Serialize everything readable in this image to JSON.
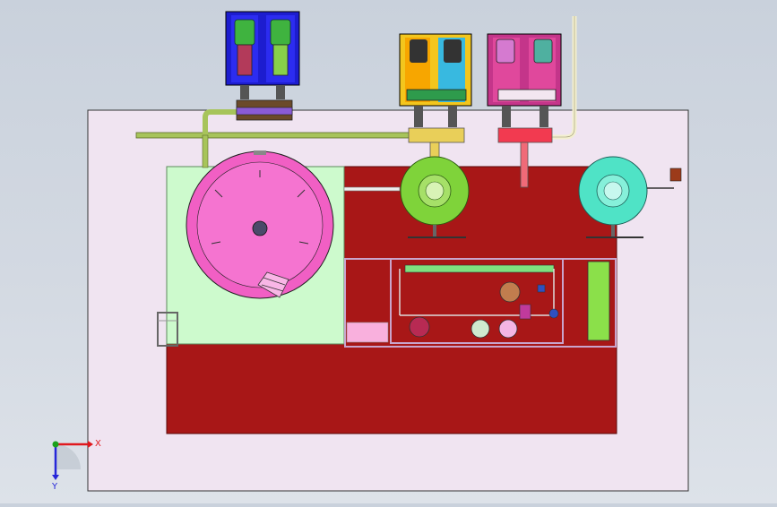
{
  "viewport": {
    "background_top": "#c9d1dc",
    "background_bottom": "#dde2e9"
  },
  "assembly": {
    "sheet_color": "#f0e4f1",
    "base_color": "#a81717",
    "platform_color": "#cdfacd",
    "tank_color": "#f15fc4",
    "pipe_color": "#a7c45a"
  },
  "triad": {
    "x_label": "X",
    "y_label": "Y",
    "x_color": "#e0191e",
    "y_color": "#2626d9",
    "origin_color": "#1aa11a"
  }
}
